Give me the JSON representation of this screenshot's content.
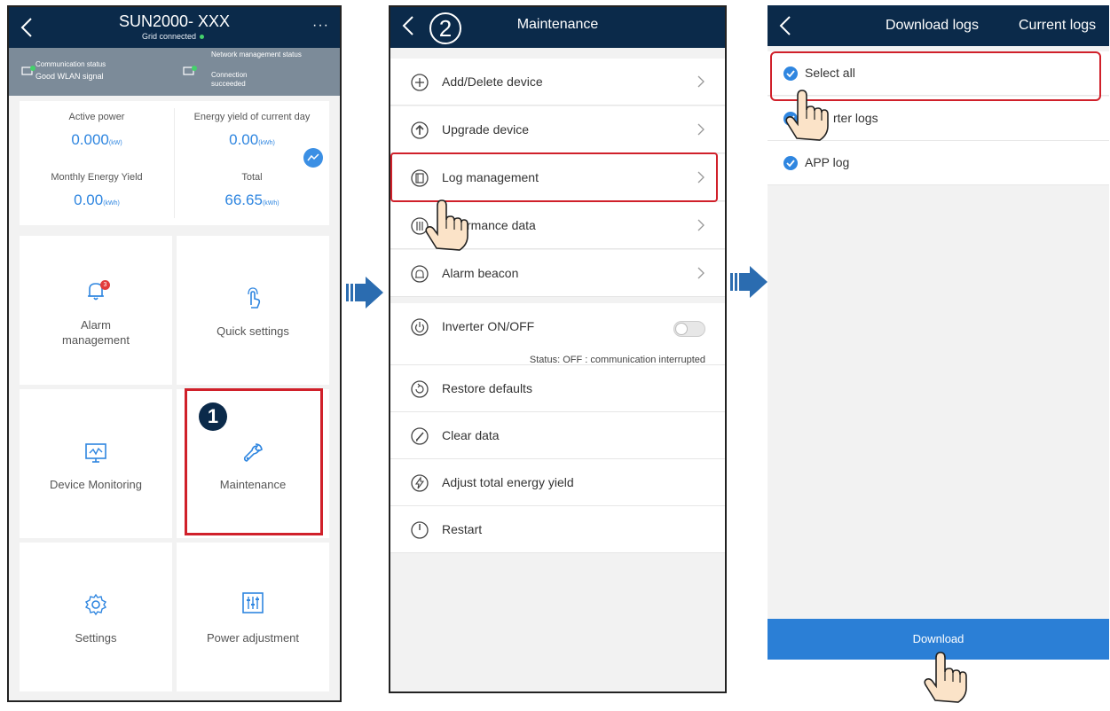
{
  "screen1": {
    "title": "SUN2000- XXX",
    "subtitle": "Grid connected",
    "more": "···",
    "status": {
      "comm_label": "Communication status",
      "comm_value": "Good WLAN signal",
      "net_label": "Network management status",
      "net_value": "Connection succeeded"
    },
    "metrics": {
      "active_power_label": "Active power",
      "active_power_value": "0.000",
      "active_power_unit": "(kW)",
      "daily_label": "Energy yield of current day",
      "daily_value": "0.00",
      "daily_unit": "(kWh)",
      "monthly_label": "Monthly Energy Yield",
      "monthly_value": "0.00",
      "monthly_unit": "(kWh)",
      "total_label": "Total",
      "total_value": "66.65",
      "total_unit": "(kWh)"
    },
    "tiles": {
      "alarm": "Alarm management",
      "alarm_badge": "3",
      "quick": "Quick settings",
      "monitoring": "Device Monitoring",
      "maintenance": "Maintenance",
      "settings": "Settings",
      "power": "Power adjustment"
    },
    "step": "1"
  },
  "screen2": {
    "title": "Maintenance",
    "step": "2",
    "items": {
      "add_delete": "Add/Delete device",
      "upgrade": "Upgrade device",
      "log": "Log management",
      "performance": "rmance data",
      "alarm_beacon": "Alarm beacon",
      "inverter": "Inverter ON/OFF",
      "restore": "Restore defaults",
      "clear": "Clear data",
      "adjust": "Adjust total energy yield",
      "restart": "Restart"
    },
    "status_note": "Status: OFF : communication interrupted"
  },
  "screen3": {
    "title": "Download logs",
    "tab2": "Current logs",
    "items": {
      "select_all": "Select all",
      "inverter_logs": "rter logs",
      "app_log": "APP log"
    },
    "download": "Download"
  },
  "colors": {
    "topbar": "#0b2a4a",
    "accent": "#2f86e0",
    "highlight": "#d0202a",
    "download": "#2b7fd6"
  },
  "icons": [
    "back-icon",
    "more-icon",
    "wlan-icon",
    "network-icon",
    "chart-icon",
    "bell-icon",
    "tap-icon",
    "monitor-icon",
    "wrench-icon",
    "gear-icon",
    "sliders-icon",
    "plus-circle-icon",
    "upload-circle-icon",
    "log-icon",
    "performance-icon",
    "beacon-icon",
    "power-icon",
    "restore-icon",
    "clear-icon",
    "lightning-icon",
    "restart-icon",
    "chevron-right-icon",
    "check-icon",
    "hand-pointer-icon",
    "right-arrow-icon"
  ]
}
